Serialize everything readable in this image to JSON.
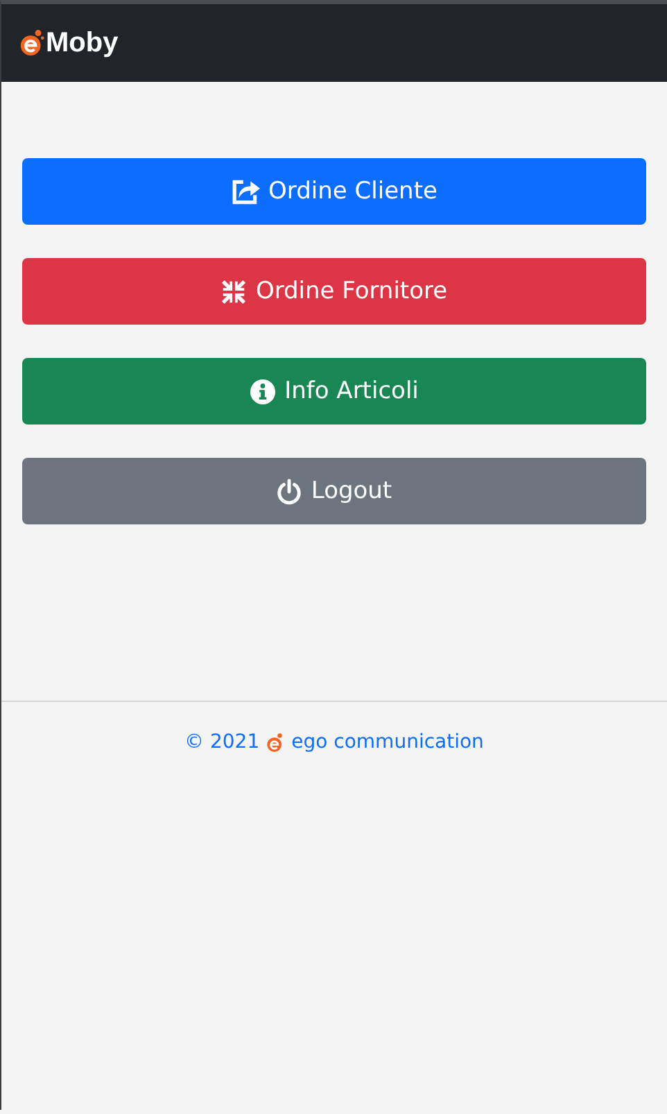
{
  "navbar": {
    "brand": "Moby"
  },
  "buttons": [
    {
      "label": "Ordine Cliente",
      "kind": "primary"
    },
    {
      "label": "Ordine Fornitore",
      "kind": "danger"
    },
    {
      "label": "Info Articoli",
      "kind": "success"
    },
    {
      "label": "Logout",
      "kind": "secondary"
    }
  ],
  "footer": {
    "copyright": "© 2021",
    "company": "ego communication"
  }
}
